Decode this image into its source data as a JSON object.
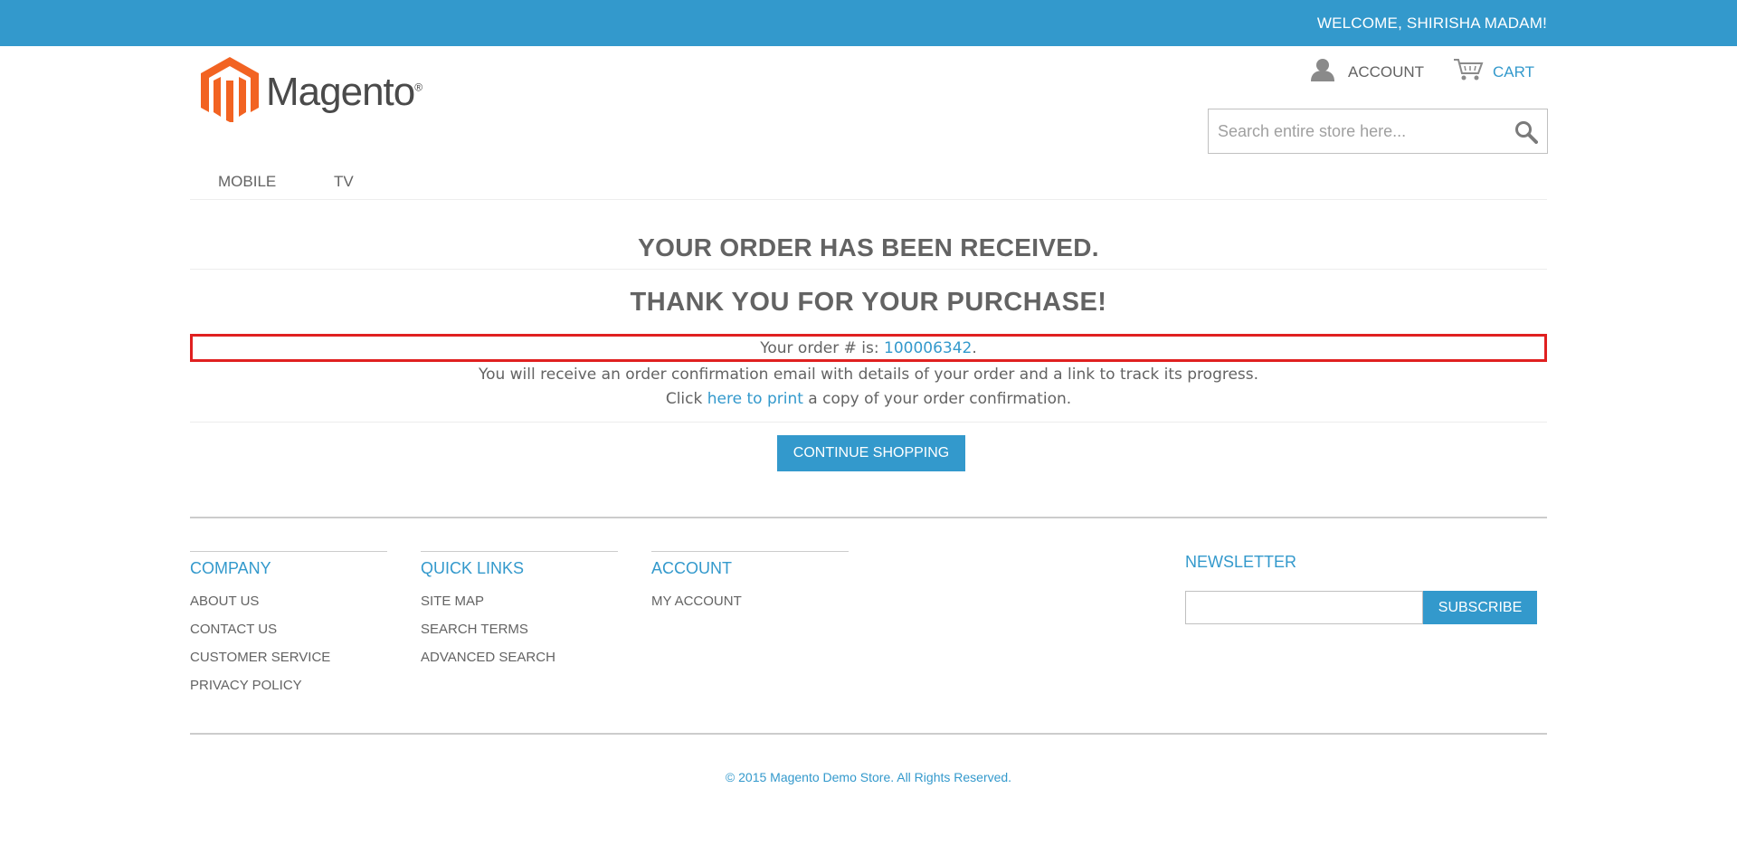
{
  "header": {
    "welcome": "WELCOME, SHIRISHA MADAM!",
    "logo_text": "Magento",
    "logo_reg": "®",
    "account_label": "ACCOUNT",
    "cart_label": "CART",
    "search_placeholder": "Search entire store here..."
  },
  "nav": {
    "items": [
      {
        "label": "MOBILE"
      },
      {
        "label": "TV"
      }
    ]
  },
  "main": {
    "title": "YOUR ORDER HAS BEEN RECEIVED.",
    "subtitle": "THANK YOU FOR YOUR PURCHASE!",
    "order_prefix": "Your order # is: ",
    "order_number": "100006342",
    "order_suffix": ".",
    "confirmation_text": "You will receive an order confirmation email with details of your order and a link to track its progress.",
    "print_prefix": "Click ",
    "print_link": "here to print",
    "print_suffix": " a copy of your order confirmation.",
    "continue_label": "CONTINUE SHOPPING"
  },
  "footer": {
    "columns": [
      {
        "title": "COMPANY",
        "links": [
          "ABOUT US",
          "CONTACT US",
          "CUSTOMER SERVICE",
          "PRIVACY POLICY"
        ]
      },
      {
        "title": "QUICK LINKS",
        "links": [
          "SITE MAP",
          "SEARCH TERMS",
          "ADVANCED SEARCH"
        ]
      },
      {
        "title": "ACCOUNT",
        "links": [
          "MY ACCOUNT"
        ]
      }
    ],
    "newsletter_title": "NEWSLETTER",
    "subscribe_label": "SUBSCRIBE",
    "copyright": "© 2015 Magento Demo Store. All Rights Reserved."
  },
  "colors": {
    "accent": "#3399cc",
    "text": "#636363",
    "highlight_border": "#e02020",
    "logo_orange": "#f26322"
  },
  "icons": [
    "magento-logo-icon",
    "account-icon",
    "cart-icon",
    "search-icon"
  ]
}
